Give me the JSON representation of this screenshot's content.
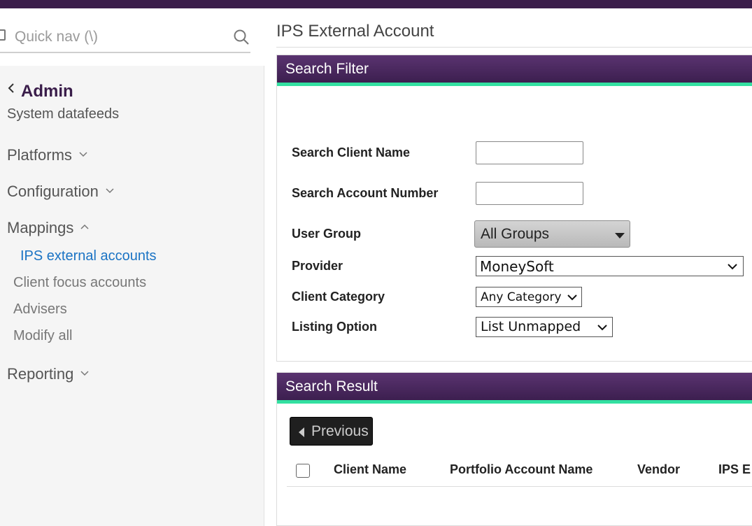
{
  "quick_nav": {
    "placeholder": "Quick nav (\\)"
  },
  "sidebar": {
    "back_title": "Admin",
    "subtitle": "System datafeeds",
    "sections": {
      "platforms": "Platforms",
      "configuration": "Configuration",
      "mappings": "Mappings",
      "reporting": "Reporting"
    },
    "mapping_items": [
      "IPS external accounts",
      "Client focus accounts",
      "Advisers",
      "Modify all"
    ],
    "active_item": "IPS external accounts"
  },
  "page": {
    "title": "IPS External Account"
  },
  "search_filter": {
    "heading": "Search Filter",
    "client_name_label": "Search Client Name",
    "client_name_value": "",
    "account_number_label": "Search Account Number",
    "account_number_value": "",
    "user_group_label": "User Group",
    "user_group_value": "All Groups",
    "provider_label": "Provider",
    "provider_value": "MoneySoft",
    "client_category_label": "Client Category",
    "client_category_value": "Any Category",
    "listing_option_label": "Listing Option",
    "listing_option_value": "List Unmapped"
  },
  "search_result": {
    "heading": "Search Result",
    "previous_label": "Previous",
    "columns": [
      "Client Name",
      "Portfolio Account Name",
      "Vendor",
      "IPS E"
    ]
  },
  "colors": {
    "header_purple": "#3a1d4a",
    "accent_green": "#33e0a1",
    "active_link": "#1a73c4"
  }
}
